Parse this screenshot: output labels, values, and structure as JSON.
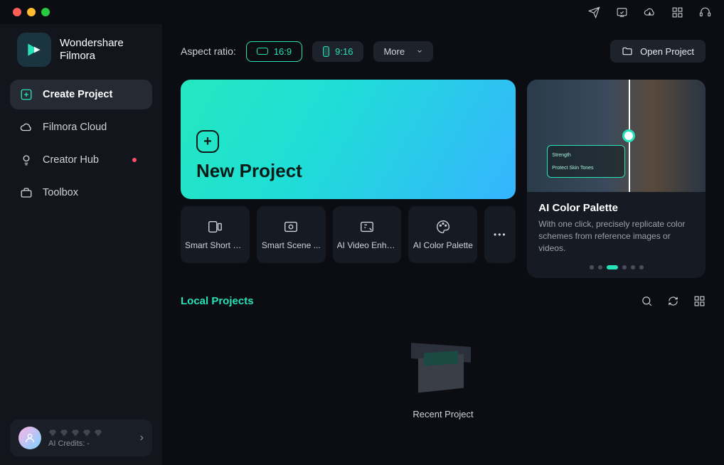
{
  "brand": {
    "line1": "Wondershare",
    "line2": "Filmora"
  },
  "nav": [
    {
      "label": "Create Project"
    },
    {
      "label": "Filmora Cloud"
    },
    {
      "label": "Creator Hub"
    },
    {
      "label": "Toolbox"
    }
  ],
  "user": {
    "credits": "AI Credits: -"
  },
  "toolbar": {
    "label": "Aspect ratio:",
    "ratio1": "16:9",
    "ratio2": "9:16",
    "more": "More",
    "openProject": "Open Project"
  },
  "newProject": {
    "title": "New Project"
  },
  "tools": [
    {
      "label": "Smart Short C..."
    },
    {
      "label": "Smart Scene ..."
    },
    {
      "label": "AI Video Enha..."
    },
    {
      "label": "AI Color Palette"
    }
  ],
  "feature": {
    "title": "AI Color Palette",
    "desc": "With one click, precisely replicate color schemes from reference images or videos.",
    "overlay1": "Strength",
    "overlay2": "Protect Skin Tones"
  },
  "local": {
    "title": "Local Projects",
    "empty": "Recent Project"
  }
}
